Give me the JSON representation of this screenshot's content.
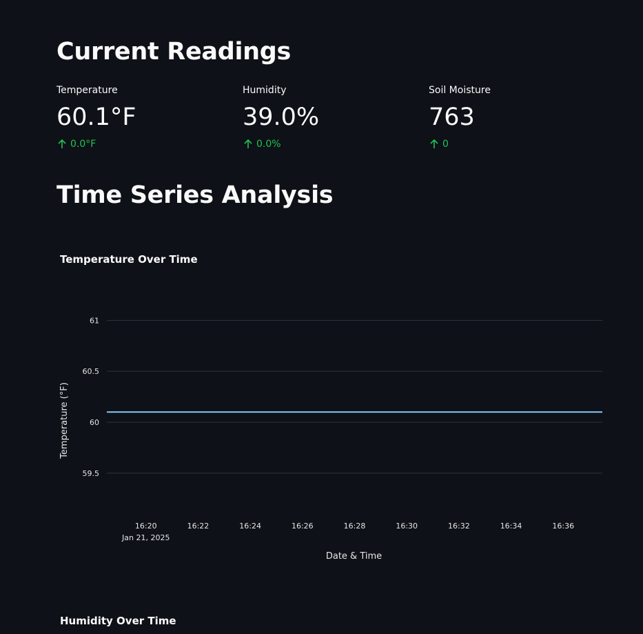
{
  "sections": {
    "current_title": "Current Readings",
    "timeseries_title": "Time Series Analysis"
  },
  "metrics": [
    {
      "label": "Temperature",
      "value": "60.1°F",
      "delta": "0.0°F"
    },
    {
      "label": "Humidity",
      "value": "39.0%",
      "delta": "0.0%"
    },
    {
      "label": "Soil Moisture",
      "value": "763",
      "delta": "0"
    }
  ],
  "colors": {
    "background": "#0e1117",
    "text": "#fafafa",
    "delta_positive": "#21c354",
    "series_line": "#83c9ff",
    "gridline": "#31333f"
  },
  "charts": {
    "temperature_title": "Temperature Over Time",
    "humidity_title": "Humidity Over Time"
  },
  "chart_data": [
    {
      "type": "line",
      "title": "Temperature Over Time",
      "xlabel": "Date & Time",
      "ylabel": "Temperature (°F)",
      "x_ticks": [
        "16:20",
        "16:22",
        "16:24",
        "16:26",
        "16:28",
        "16:30",
        "16:32",
        "16:34",
        "16:36"
      ],
      "x_tick_sublabel": "Jan 21, 2025",
      "y_ticks": [
        59.5,
        60,
        60.5,
        61
      ],
      "y_tick_labels": [
        "59.5",
        "60",
        "60.5",
        "61"
      ],
      "ylim": [
        59.1,
        61.3
      ],
      "grid": true,
      "series": [
        {
          "x": [
            "2025-01-21 16:18:30",
            "2025-01-21 16:37:30"
          ],
          "y": [
            60.1,
            60.1
          ]
        }
      ]
    }
  ]
}
